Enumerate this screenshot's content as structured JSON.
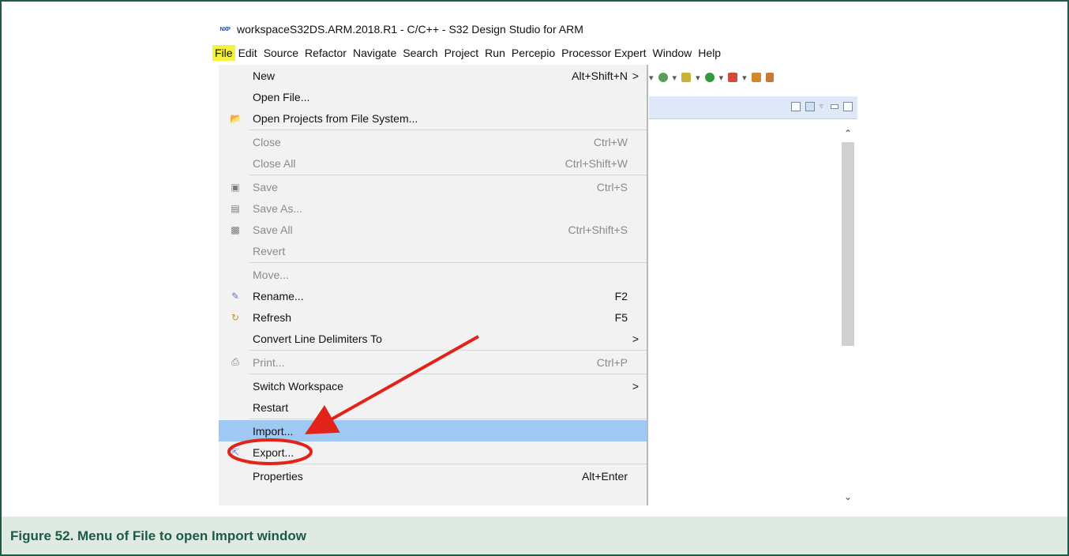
{
  "window": {
    "logo": "NXP",
    "title": "workspaceS32DS.ARM.2018.R1 - C/C++ - S32 Design Studio for ARM"
  },
  "menubar": {
    "items": [
      "File",
      "Edit",
      "Source",
      "Refactor",
      "Navigate",
      "Search",
      "Project",
      "Run",
      "Percepio",
      "Processor Expert",
      "Window",
      "Help"
    ],
    "active": "File"
  },
  "file_menu": {
    "items": [
      {
        "label": "New",
        "shortcut": "Alt+Shift+N",
        "submenu": true,
        "enabled": true,
        "icon": ""
      },
      {
        "label": "Open File...",
        "shortcut": "",
        "submenu": false,
        "enabled": true,
        "icon": ""
      },
      {
        "label": "Open Projects from File System...",
        "shortcut": "",
        "submenu": false,
        "enabled": true,
        "icon": "folder-icon"
      },
      {
        "label": "Close",
        "shortcut": "Ctrl+W",
        "submenu": false,
        "enabled": false,
        "icon": ""
      },
      {
        "label": "Close All",
        "shortcut": "Ctrl+Shift+W",
        "submenu": false,
        "enabled": false,
        "icon": ""
      },
      {
        "label": "Save",
        "shortcut": "Ctrl+S",
        "submenu": false,
        "enabled": false,
        "icon": "save-icon"
      },
      {
        "label": "Save As...",
        "shortcut": "",
        "submenu": false,
        "enabled": false,
        "icon": "save-as-icon"
      },
      {
        "label": "Save All",
        "shortcut": "Ctrl+Shift+S",
        "submenu": false,
        "enabled": false,
        "icon": "save-all-icon"
      },
      {
        "label": "Revert",
        "shortcut": "",
        "submenu": false,
        "enabled": false,
        "icon": ""
      },
      {
        "label": "Move...",
        "shortcut": "",
        "submenu": false,
        "enabled": false,
        "icon": ""
      },
      {
        "label": "Rename...",
        "shortcut": "F2",
        "submenu": false,
        "enabled": true,
        "icon": "rename-icon"
      },
      {
        "label": "Refresh",
        "shortcut": "F5",
        "submenu": false,
        "enabled": true,
        "icon": "refresh-icon"
      },
      {
        "label": "Convert Line Delimiters To",
        "shortcut": "",
        "submenu": true,
        "enabled": true,
        "icon": ""
      },
      {
        "label": "Print...",
        "shortcut": "Ctrl+P",
        "submenu": false,
        "enabled": false,
        "icon": "print-icon"
      },
      {
        "label": "Switch Workspace",
        "shortcut": "",
        "submenu": true,
        "enabled": true,
        "icon": ""
      },
      {
        "label": "Restart",
        "shortcut": "",
        "submenu": false,
        "enabled": true,
        "icon": ""
      },
      {
        "label": "Import...",
        "shortcut": "",
        "submenu": false,
        "enabled": true,
        "icon": "",
        "highlighted": true
      },
      {
        "label": "Export...",
        "shortcut": "",
        "submenu": false,
        "enabled": true,
        "icon": "export-icon"
      },
      {
        "label": "Properties",
        "shortcut": "Alt+Enter",
        "submenu": false,
        "enabled": true,
        "icon": ""
      }
    ],
    "submenu_glyph": ">"
  },
  "colors": {
    "highlight": "#9fc9f3",
    "menu_bg": "#f2f2f2",
    "annotation_red": "#e2231a",
    "caption_text": "#1c5a4a",
    "caption_bg": "#dfeae3",
    "file_highlight": "#f4f23a"
  },
  "caption": "Figure 52. Menu of File to open Import window"
}
